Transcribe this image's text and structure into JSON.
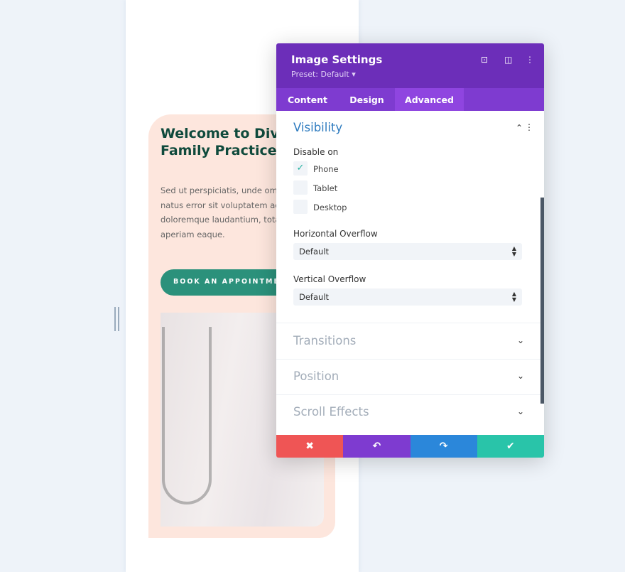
{
  "page": {
    "heading_lines": "Welcome to Divi\nFamily Practice",
    "body_lines": "Sed ut perspiciatis, unde om\nnatus error sit voluptatem ac\ndoloremque laudantium, tota\naperiam eaque.",
    "cta_label": "BOOK AN APPOINTMENT"
  },
  "panel": {
    "title": "Image Settings",
    "preset": "Preset: Default ▾",
    "icons": {
      "focus": "⊡",
      "sidebar": "◫",
      "more": "⋮"
    },
    "tabs": [
      "Content",
      "Design",
      "Advanced"
    ],
    "active_tab": "Advanced",
    "visibility": {
      "title": "Visibility",
      "disable_on_label": "Disable on",
      "options": [
        {
          "label": "Phone",
          "checked": true
        },
        {
          "label": "Tablet",
          "checked": false
        },
        {
          "label": "Desktop",
          "checked": false
        }
      ]
    },
    "horizontal_overflow": {
      "label": "Horizontal Overflow",
      "value": "Default"
    },
    "vertical_overflow": {
      "label": "Vertical Overflow",
      "value": "Default"
    },
    "sections": [
      "Transitions",
      "Position",
      "Scroll Effects"
    ],
    "footer": {
      "cancel": "✖",
      "undo": "↶",
      "redo": "↷",
      "save": "✔"
    },
    "colors": {
      "header": "#6c2eb9",
      "tabs": "#7e3bd0",
      "cancel": "#ef5555",
      "undo": "#7e3bd0",
      "redo": "#2b87da",
      "save": "#29c4a9"
    }
  }
}
